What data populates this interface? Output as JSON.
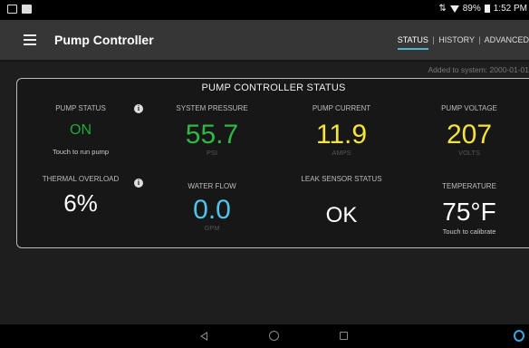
{
  "status_bar": {
    "battery": "89%",
    "time": "1:52 PM"
  },
  "app": {
    "title": "Pump Controller",
    "menu_icon": "hamburger-menu-icon",
    "tabs": [
      {
        "label": "STATUS",
        "active": true
      },
      {
        "label": "HISTORY",
        "active": false
      },
      {
        "label": "ADVANCED",
        "active": false
      }
    ],
    "added_to_system": "Added to system: 2000-01-01"
  },
  "panel": {
    "title": "PUMP CONTROLLER STATUS",
    "pump_status": {
      "label": "PUMP STATUS",
      "value": "ON",
      "hint": "Touch to run pump",
      "color": "#1faa3c"
    },
    "system_pressure": {
      "label": "SYSTEM PRESSURE",
      "value": "55.7",
      "unit": "PSI",
      "color": "#2eb845"
    },
    "pump_current": {
      "label": "PUMP CURRENT",
      "value": "11.9",
      "unit": "AMPS",
      "color": "#f3e33b"
    },
    "pump_voltage": {
      "label": "PUMP VOLTAGE",
      "value": "207",
      "unit": "VOLTS",
      "color": "#f3e33b"
    },
    "thermal_overload": {
      "label": "THERMAL OVERLOAD",
      "value": "6%",
      "color": "#ffffff"
    },
    "water_flow": {
      "label": "WATER FLOW",
      "value": "0.0",
      "unit": "GPM",
      "color": "#4fc3e8"
    },
    "leak_sensor": {
      "label": "LEAK SENSOR STATUS",
      "value": "OK",
      "color": "#ffffff"
    },
    "temperature": {
      "label": "TEMPERATURE",
      "value": "75°F",
      "hint": "Touch to calibrate",
      "color": "#ffffff"
    }
  },
  "colors": {
    "accent": "#4bb8c8",
    "appbar": "#363636",
    "panel_bg": "#171717"
  }
}
